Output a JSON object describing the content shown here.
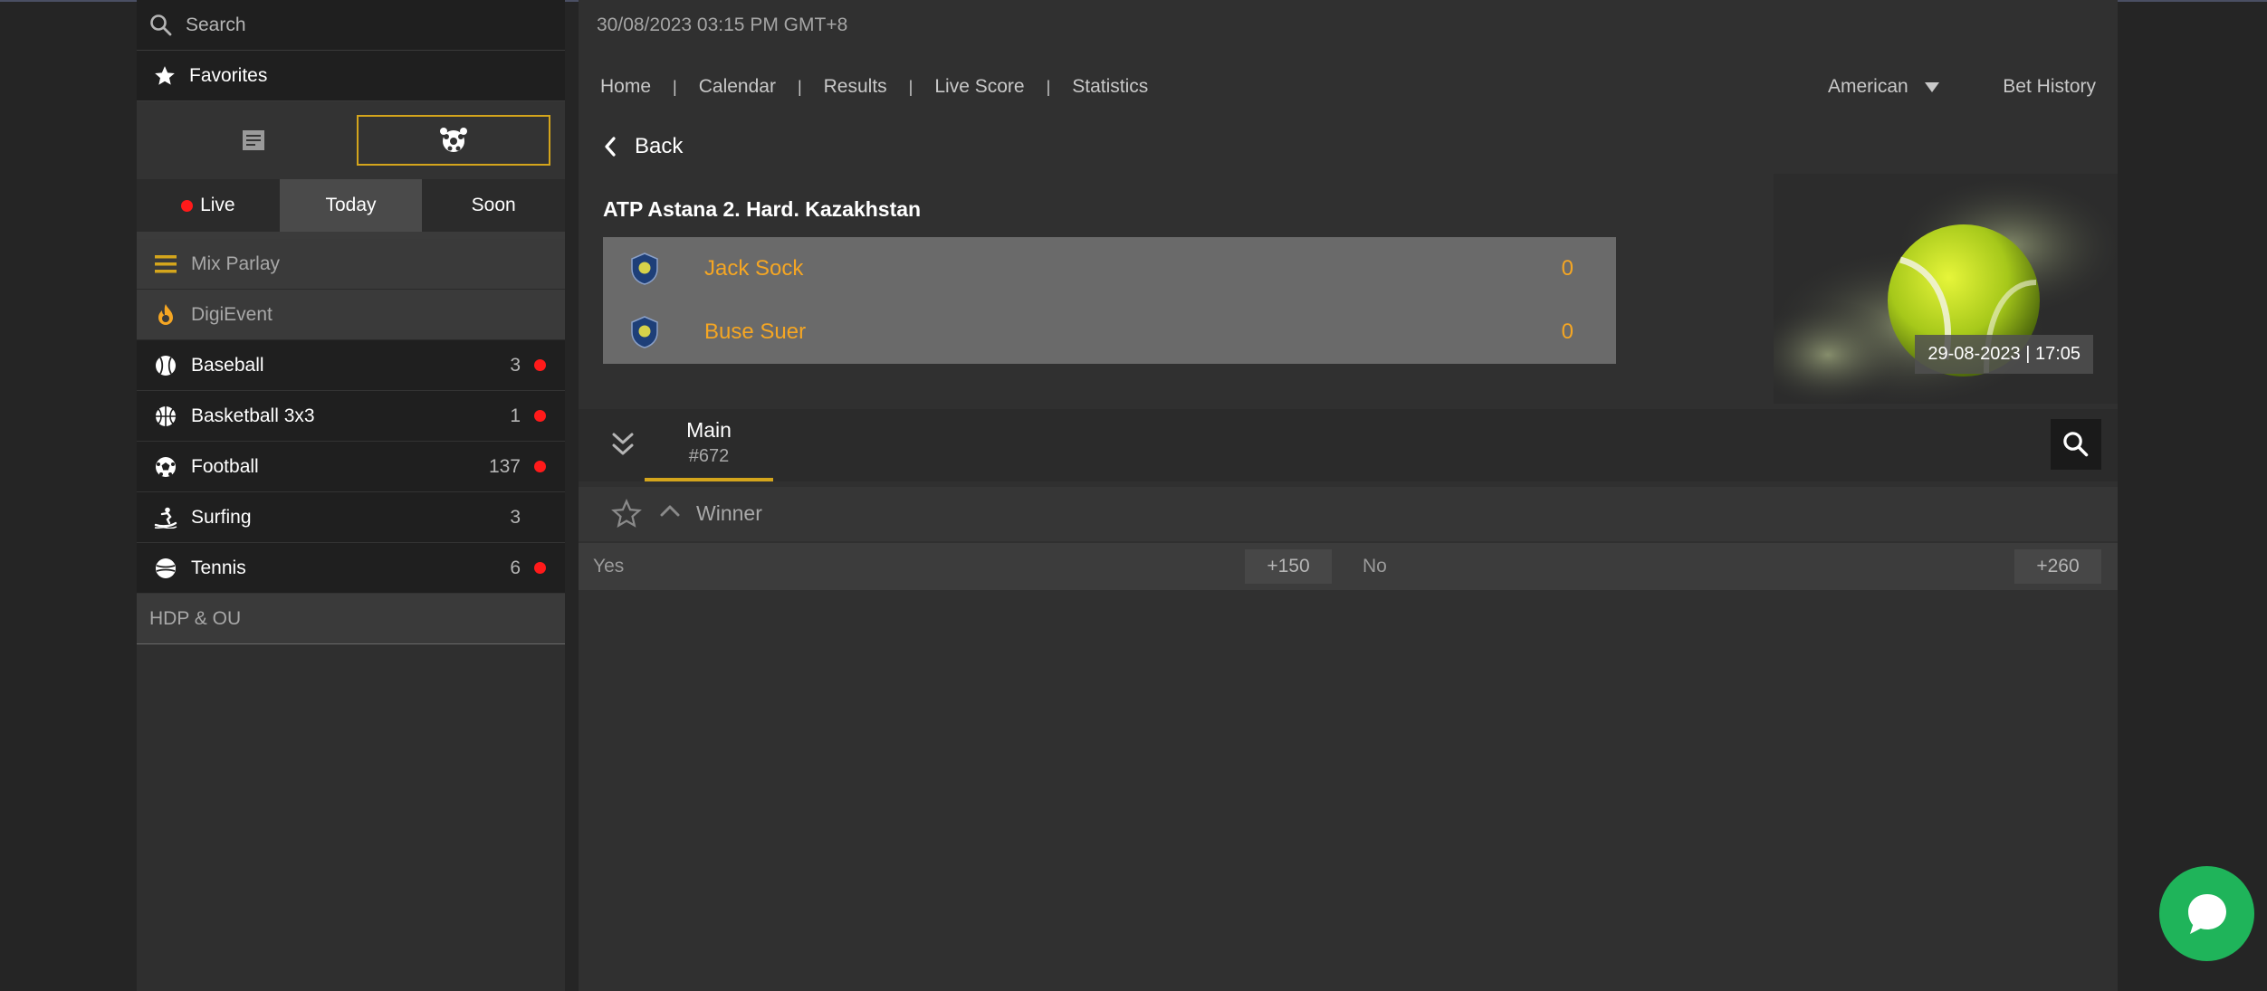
{
  "sidebar": {
    "search_placeholder": "Search",
    "favorites_label": "Favorites",
    "time_tabs": [
      {
        "label": "Live"
      },
      {
        "label": "Today"
      },
      {
        "label": "Soon"
      }
    ],
    "menu": [
      {
        "label": "Mix Parlay",
        "icon": "list-icon"
      },
      {
        "label": "DigiEvent",
        "icon": "flame-icon"
      }
    ],
    "sports": [
      {
        "label": "Baseball",
        "count": "3",
        "live": true,
        "icon": "baseball-icon"
      },
      {
        "label": "Basketball 3x3",
        "count": "1",
        "live": true,
        "icon": "basketball-icon"
      },
      {
        "label": "Football",
        "count": "137",
        "live": true,
        "icon": "football-icon"
      },
      {
        "label": "Surfing",
        "count": "3",
        "live": false,
        "icon": "surfing-icon"
      },
      {
        "label": "Tennis",
        "count": "6",
        "live": true,
        "icon": "tennis-icon"
      }
    ],
    "hdp_label": "HDP & OU"
  },
  "header": {
    "datetime": "30/08/2023 03:15 PM GMT+8",
    "nav": [
      "Home",
      "Calendar",
      "Results",
      "Live Score",
      "Statistics"
    ],
    "odds_format": "American",
    "bet_history": "Bet History"
  },
  "match": {
    "back_label": "Back",
    "league": "ATP Astana 2. Hard. Kazakhstan",
    "teams": [
      {
        "name": "Jack Sock",
        "score": "0"
      },
      {
        "name": "Buse Suer",
        "score": "0"
      }
    ],
    "start_time": "29-08-2023 | 17:05"
  },
  "markets": {
    "tab_label": "Main",
    "tab_count": "#672",
    "market_name": "Winner",
    "selections": [
      {
        "label": "Yes",
        "price": "+150"
      },
      {
        "label": "No",
        "price": "+260"
      }
    ]
  },
  "colors": {
    "accent": "#d4a51c",
    "team_text": "#f5a623",
    "live_dot": "#ff1a1a",
    "chat": "#1fb45a"
  }
}
